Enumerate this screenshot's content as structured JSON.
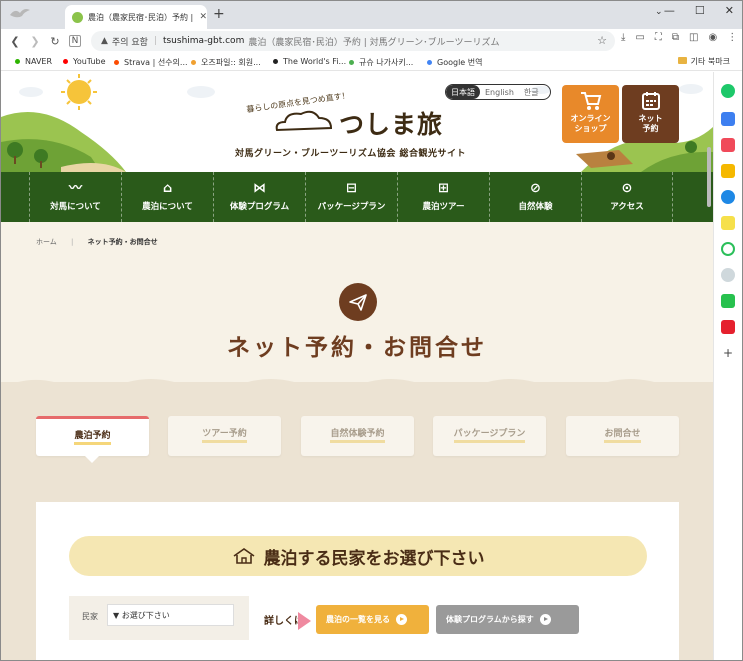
{
  "browser": {
    "tab_title": "農泊（農家民宿･民泊）予約 | 対",
    "address": {
      "security_label": "주의 요함",
      "domain": "tsushima-gbt.com",
      "path": "農泊（農家民宿･民泊）予約 | 対馬グリーン･ブルーツーリズム"
    },
    "bookmarks": [
      {
        "label": "NAVER",
        "color": "#2db400"
      },
      {
        "label": "YouTube",
        "color": "#ff0000"
      },
      {
        "label": "Strava | 선수의...",
        "color": "#fc4c02"
      },
      {
        "label": "오즈파일:: 회원...",
        "color": "#f0a030"
      },
      {
        "label": "The World's Fi...",
        "color": "#222222"
      },
      {
        "label": "규슈 나가사키...",
        "color": "#4caf50"
      },
      {
        "label": "Google 번역",
        "color": "#4285f4"
      }
    ],
    "bookmark_folder": "기타 북마크"
  },
  "header": {
    "tagline": "暮らしの原点を見つめ直す！",
    "logo": "つしま旅",
    "subtitle": "対馬グリーン・ブルーツーリズム協会 総合観光サイト",
    "languages": [
      "日本語",
      "English",
      "한글"
    ],
    "shop_label_1": "オンライン",
    "shop_label_2": "ショップ",
    "net_label_1": "ネット",
    "net_label_2": "予約"
  },
  "nav": [
    {
      "label": "対馬について",
      "icon": "whale-icon"
    },
    {
      "label": "農泊について",
      "icon": "house-icon"
    },
    {
      "label": "体験プログラム",
      "icon": "fish-icon"
    },
    {
      "label": "パッケージプラン",
      "icon": "gift-box-icon"
    },
    {
      "label": "農泊ツアー",
      "icon": "map-icon"
    },
    {
      "label": "自然体験",
      "icon": "leaf-icon"
    },
    {
      "label": "アクセス",
      "icon": "pin-icon"
    }
  ],
  "breadcrumb": {
    "home": "ホーム",
    "current": "ネット予約・お問合せ"
  },
  "page_title": "ネット予約・お問合せ",
  "tabs": [
    "農泊予約",
    "ツアー予約",
    "自然体験予約",
    "パッケージプラン",
    "お問合せ"
  ],
  "panel": {
    "heading": "農泊する民家をお選び下さい",
    "filter_label": "民家",
    "filter_value": "▼ お選び下さい",
    "detail_label": "詳しくは",
    "btn_list": "農泊の一覧を見る",
    "btn_program": "体験プログラムから探す"
  }
}
